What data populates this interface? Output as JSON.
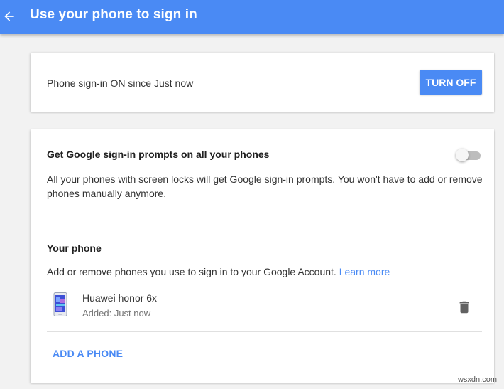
{
  "header": {
    "title": "Use your phone to sign in",
    "back_icon": "arrow-back-icon"
  },
  "status_card": {
    "text": "Phone sign-in ON since Just now",
    "button_label": "TURN OFF"
  },
  "prompts": {
    "title": "Get Google sign-in prompts on all your phones",
    "description": "All your phones with screen locks will get Google sign-in prompts. You won't have to add or remove phones manually anymore.",
    "toggle_on": false
  },
  "your_phone": {
    "title": "Your phone",
    "description": "Add or remove phones you use to sign in to your Google Account.",
    "learn_more": "Learn more",
    "devices": [
      {
        "name": "Huawei honor 6x",
        "added": "Added: Just now",
        "icon": "smartphone-icon"
      }
    ],
    "add_label": "ADD A PHONE",
    "delete_icon": "trash-icon"
  },
  "colors": {
    "accent": "#4a8af4",
    "background": "#f2f2f2"
  },
  "watermark": "wsxdn.com"
}
